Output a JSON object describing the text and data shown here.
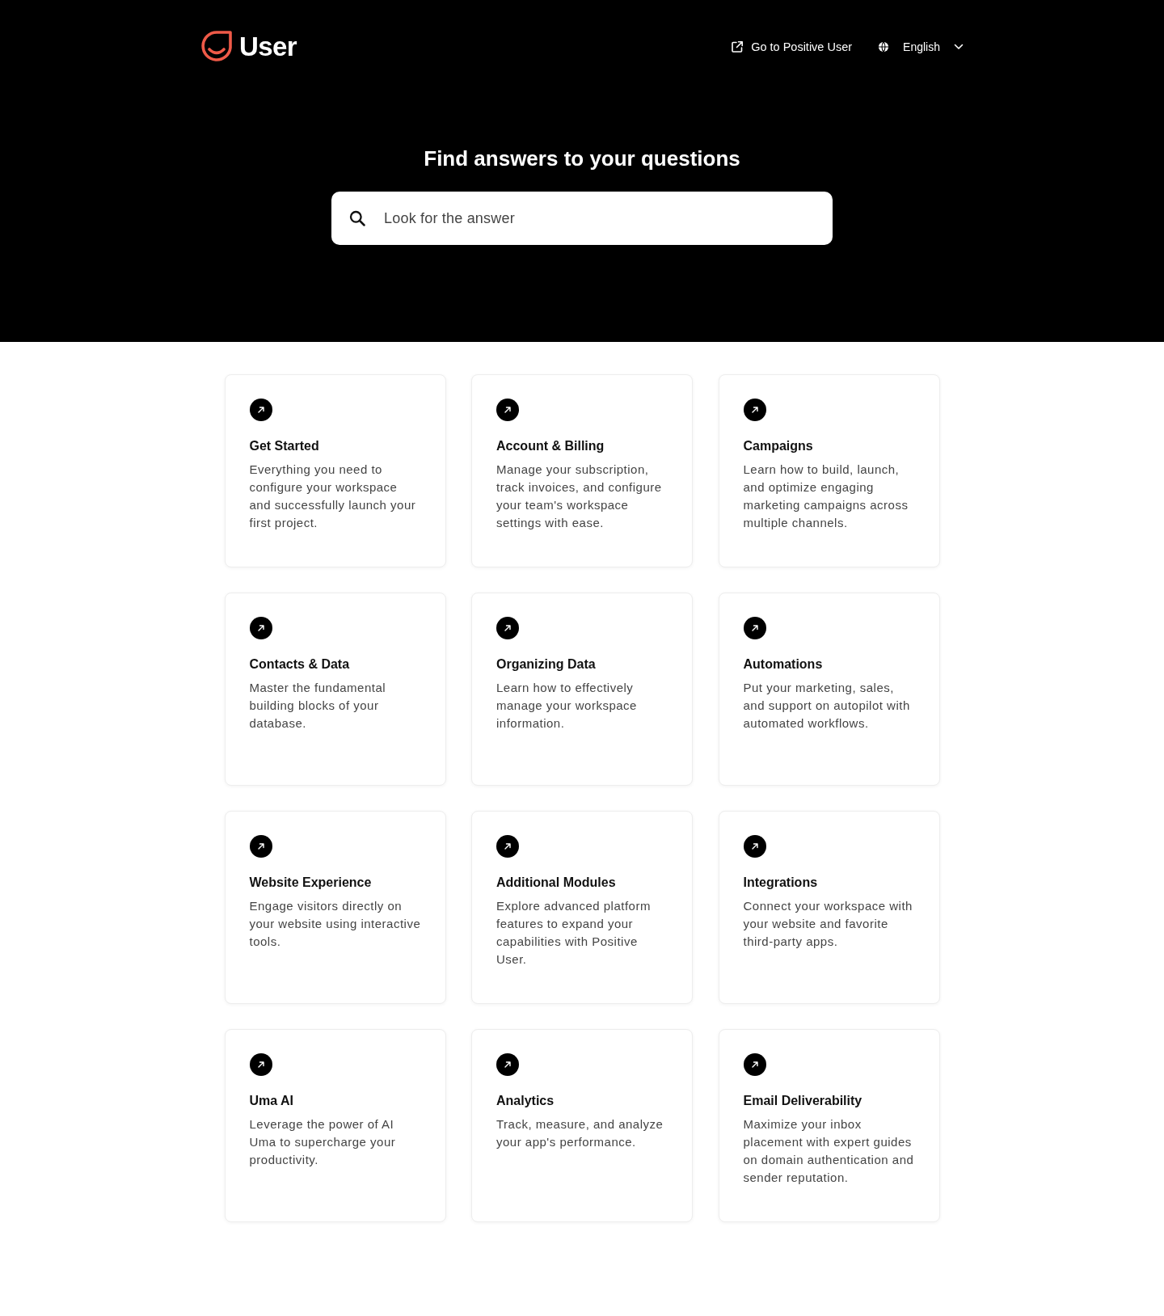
{
  "header": {
    "logo": {
      "text": "User"
    },
    "nav": [
      {
        "kind": "link",
        "label": "Go to Positive User"
      },
      {
        "kind": "language",
        "label": "English"
      }
    ]
  },
  "hero": {
    "title": "Find answers to your questions",
    "search": {
      "placeholder": "Look for the answer"
    }
  },
  "categories": [
    {
      "title": "Get Started",
      "description": "Everything you need to configure your workspace and successfully launch your first project."
    },
    {
      "title": "Account & Billing",
      "description": "Manage your subscription, track invoices, and configure your team's workspace settings with ease."
    },
    {
      "title": "Campaigns",
      "description": "Learn how to build, launch, and optimize engaging marketing campaigns across multiple channels."
    },
    {
      "title": "Contacts & Data",
      "description": "Master the fundamental building blocks of your database."
    },
    {
      "title": "Organizing Data",
      "description": "Learn how to effectively manage your workspace information."
    },
    {
      "title": "Automations",
      "description": "Put your marketing, sales, and support on autopilot with automated workflows."
    },
    {
      "title": "Website Experience",
      "description": "Engage visitors directly on your website using interactive tools."
    },
    {
      "title": "Additional Modules",
      "description": "Explore advanced platform features to expand your capabilities with Positive User."
    },
    {
      "title": "Integrations",
      "description": "Connect your workspace with your website and favorite third-party apps."
    },
    {
      "title": "Uma AI",
      "description": "Leverage the power of AI Uma to supercharge your productivity."
    },
    {
      "title": "Analytics",
      "description": "Track, measure, and analyze your app's performance."
    },
    {
      "title": "Email Deliverability",
      "description": "Maximize your inbox placement with expert guides on domain authentication and sender reputation."
    }
  ]
}
